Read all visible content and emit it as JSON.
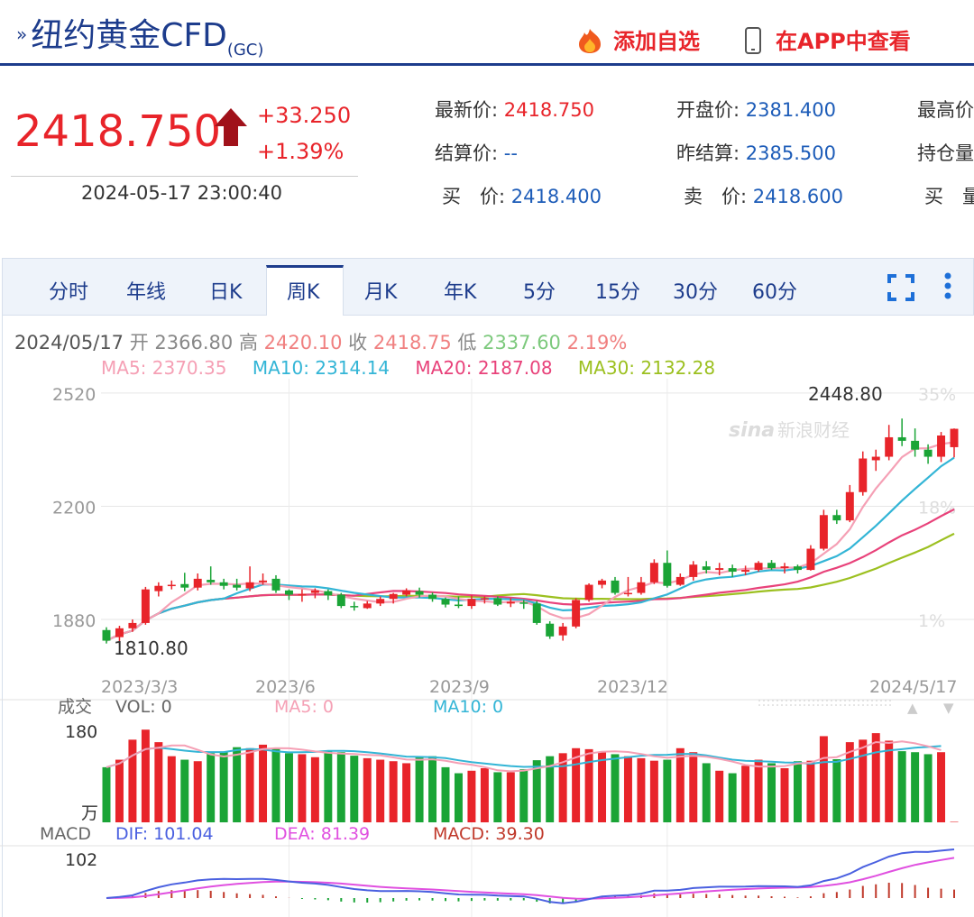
{
  "header": {
    "title": "纽约黄金CFD",
    "title_sub": "(GC)",
    "add_fav_label": "添加自选",
    "app_view_label": "在APP中查看",
    "brand_color": "#1d3c8c",
    "accent_color": "#e8242a"
  },
  "quote": {
    "price": "2418.750",
    "change": "+33.250",
    "change_pct": "+1.39%",
    "timestamp": "2024-05-17 23:00:40",
    "latest_label": "最新价:",
    "latest_value": "2418.750",
    "open_label": "开盘价:",
    "open_value": "2381.400",
    "high_label": "最高价",
    "settle_label": "结算价:",
    "settle_value": "--",
    "prev_settle_label": "昨结算:",
    "prev_settle_value": "2385.500",
    "open_interest_label": "持仓量",
    "bid_label": "买　价:",
    "bid_value": "2418.400",
    "ask_label": "卖　价:",
    "ask_value": "2418.600",
    "bid_vol_label": "买　量"
  },
  "tabs": [
    {
      "label": "分时"
    },
    {
      "label": "年线"
    },
    {
      "label": "日K"
    },
    {
      "label": "周K",
      "active": true
    },
    {
      "label": "月K"
    },
    {
      "label": "年K"
    },
    {
      "label": "5分"
    },
    {
      "label": "15分"
    },
    {
      "label": "30分"
    },
    {
      "label": "60分"
    }
  ],
  "tab_icons": [
    "fullscreen-icon",
    "more-vertical-icon"
  ],
  "bar_info": {
    "date": "2024/05/17",
    "open_label": "开",
    "open": "2366.80",
    "high_label": "高",
    "high": "2420.10",
    "close_label": "收",
    "close": "2418.75",
    "low_label": "低",
    "low": "2337.60",
    "pct": "2.19%"
  },
  "ma": {
    "ma5_label": "MA5: 2370.35",
    "ma10_label": "MA10: 2314.14",
    "ma20_label": "MA20: 2187.08",
    "ma30_label": "MA30: 2132.28",
    "ma5_color": "#f5a0b5",
    "ma10_color": "#33b5d6",
    "ma20_color": "#e8427a",
    "ma30_color": "#9cc020"
  },
  "watermark": "新浪财经",
  "chart_data": {
    "type": "candlestick",
    "price_ticks": [
      "2520",
      "2200",
      "1880"
    ],
    "pct_ticks": [
      "35%",
      "18%",
      "1%"
    ],
    "date_ticks": [
      "2023/3/3",
      "2023/6",
      "2023/9",
      "2023/12",
      "2024/5/17"
    ],
    "max_label": "2448.80",
    "min_label": "1810.80",
    "ylim": [
      1750,
      2530
    ],
    "weekly": [
      [
        1850,
        1820,
        1858,
        1812
      ],
      [
        1830,
        1855,
        1862,
        1810
      ],
      [
        1855,
        1870,
        1880,
        1845
      ],
      [
        1870,
        1965,
        1972,
        1865
      ],
      [
        1960,
        1975,
        1985,
        1945
      ],
      [
        1975,
        1978,
        1990,
        1965
      ],
      [
        1980,
        1970,
        2012,
        1960
      ],
      [
        1970,
        1995,
        2010,
        1962
      ],
      [
        1992,
        1985,
        2030,
        1978
      ],
      [
        1985,
        1975,
        1995,
        1965
      ],
      [
        1978,
        1970,
        1995,
        1962
      ],
      [
        1968,
        1985,
        2030,
        1960
      ],
      [
        1985,
        1990,
        2010,
        1978
      ],
      [
        1995,
        1962,
        2005,
        1955
      ],
      [
        1962,
        1950,
        1965,
        1935
      ],
      [
        1950,
        1952,
        1965,
        1930
      ],
      [
        1955,
        1962,
        1968,
        1940
      ],
      [
        1960,
        1948,
        1965,
        1935
      ],
      [
        1950,
        1918,
        1955,
        1912
      ],
      [
        1918,
        1915,
        1930,
        1905
      ],
      [
        1912,
        1925,
        1932,
        1910
      ],
      [
        1925,
        1938,
        1945,
        1918
      ],
      [
        1938,
        1952,
        1955,
        1925
      ],
      [
        1950,
        1962,
        1968,
        1945
      ],
      [
        1960,
        1950,
        1970,
        1942
      ],
      [
        1950,
        1938,
        1956,
        1930
      ],
      [
        1938,
        1922,
        1942,
        1914
      ],
      [
        1922,
        1918,
        1945,
        1912
      ],
      [
        1918,
        1938,
        1948,
        1910
      ],
      [
        1938,
        1940,
        1945,
        1925
      ],
      [
        1940,
        1922,
        1945,
        1918
      ],
      [
        1925,
        1930,
        1940,
        1915
      ],
      [
        1928,
        1925,
        1935,
        1910
      ],
      [
        1925,
        1870,
        1932,
        1865
      ],
      [
        1868,
        1832,
        1875,
        1825
      ],
      [
        1835,
        1860,
        1870,
        1820
      ],
      [
        1860,
        1935,
        1940,
        1855
      ],
      [
        1935,
        1978,
        1982,
        1930
      ],
      [
        1978,
        1990,
        1995,
        1968
      ],
      [
        1990,
        1955,
        2000,
        1950
      ],
      [
        1952,
        1955,
        2000,
        1945
      ],
      [
        1955,
        1985,
        2000,
        1950
      ],
      [
        1985,
        2040,
        2050,
        1980
      ],
      [
        2040,
        1975,
        2075,
        1970
      ],
      [
        1978,
        2000,
        2010,
        1975
      ],
      [
        2000,
        2035,
        2045,
        1990
      ],
      [
        2030,
        2020,
        2045,
        2010
      ],
      [
        2020,
        2025,
        2040,
        2005
      ],
      [
        2025,
        2015,
        2035,
        2000
      ],
      [
        2015,
        2020,
        2032,
        2005
      ],
      [
        2020,
        2040,
        2045,
        2015
      ],
      [
        2040,
        2025,
        2048,
        2020
      ],
      [
        2025,
        2030,
        2040,
        2010
      ],
      [
        2030,
        2020,
        2035,
        2010
      ],
      [
        2020,
        2080,
        2090,
        2018
      ],
      [
        2080,
        2175,
        2190,
        2075
      ],
      [
        2175,
        2160,
        2190,
        2150
      ],
      [
        2160,
        2240,
        2260,
        2155
      ],
      [
        2240,
        2335,
        2355,
        2230
      ],
      [
        2330,
        2340,
        2360,
        2300
      ],
      [
        2340,
        2395,
        2430,
        2330
      ],
      [
        2395,
        2385,
        2448,
        2370
      ],
      [
        2385,
        2360,
        2420,
        2340
      ],
      [
        2360,
        2340,
        2375,
        2320
      ],
      [
        2340,
        2400,
        2410,
        2325
      ],
      [
        2367,
        2419,
        2420,
        2338
      ]
    ]
  },
  "volume": {
    "title": "成交",
    "vol_label": "VOL: 0",
    "ma5_label": "MA5: 0",
    "ma10_label": "MA10: 0",
    "top_tick": "180",
    "unit": "万",
    "values": [
      110,
      125,
      165,
      185,
      160,
      132,
      125,
      122,
      138,
      140,
      150,
      148,
      155,
      148,
      138,
      136,
      130,
      142,
      140,
      133,
      128,
      125,
      122,
      118,
      132,
      132,
      110,
      98,
      103,
      108,
      100,
      100,
      106,
      124,
      132,
      138,
      148,
      146,
      140,
      136,
      132,
      128,
      123,
      125,
      148,
      140,
      118,
      103,
      98,
      113,
      125,
      118,
      108,
      122,
      123,
      172,
      126,
      160,
      165,
      178,
      163,
      142,
      140,
      136,
      140,
      1
    ]
  },
  "macd": {
    "title": "MACD",
    "dif_label": "DIF: 101.04",
    "dea_label": "DEA: 81.39",
    "macd_label": "MACD: 39.30",
    "top_tick": "102",
    "dif_color": "#4a60e0",
    "dea_color": "#e050e0"
  }
}
